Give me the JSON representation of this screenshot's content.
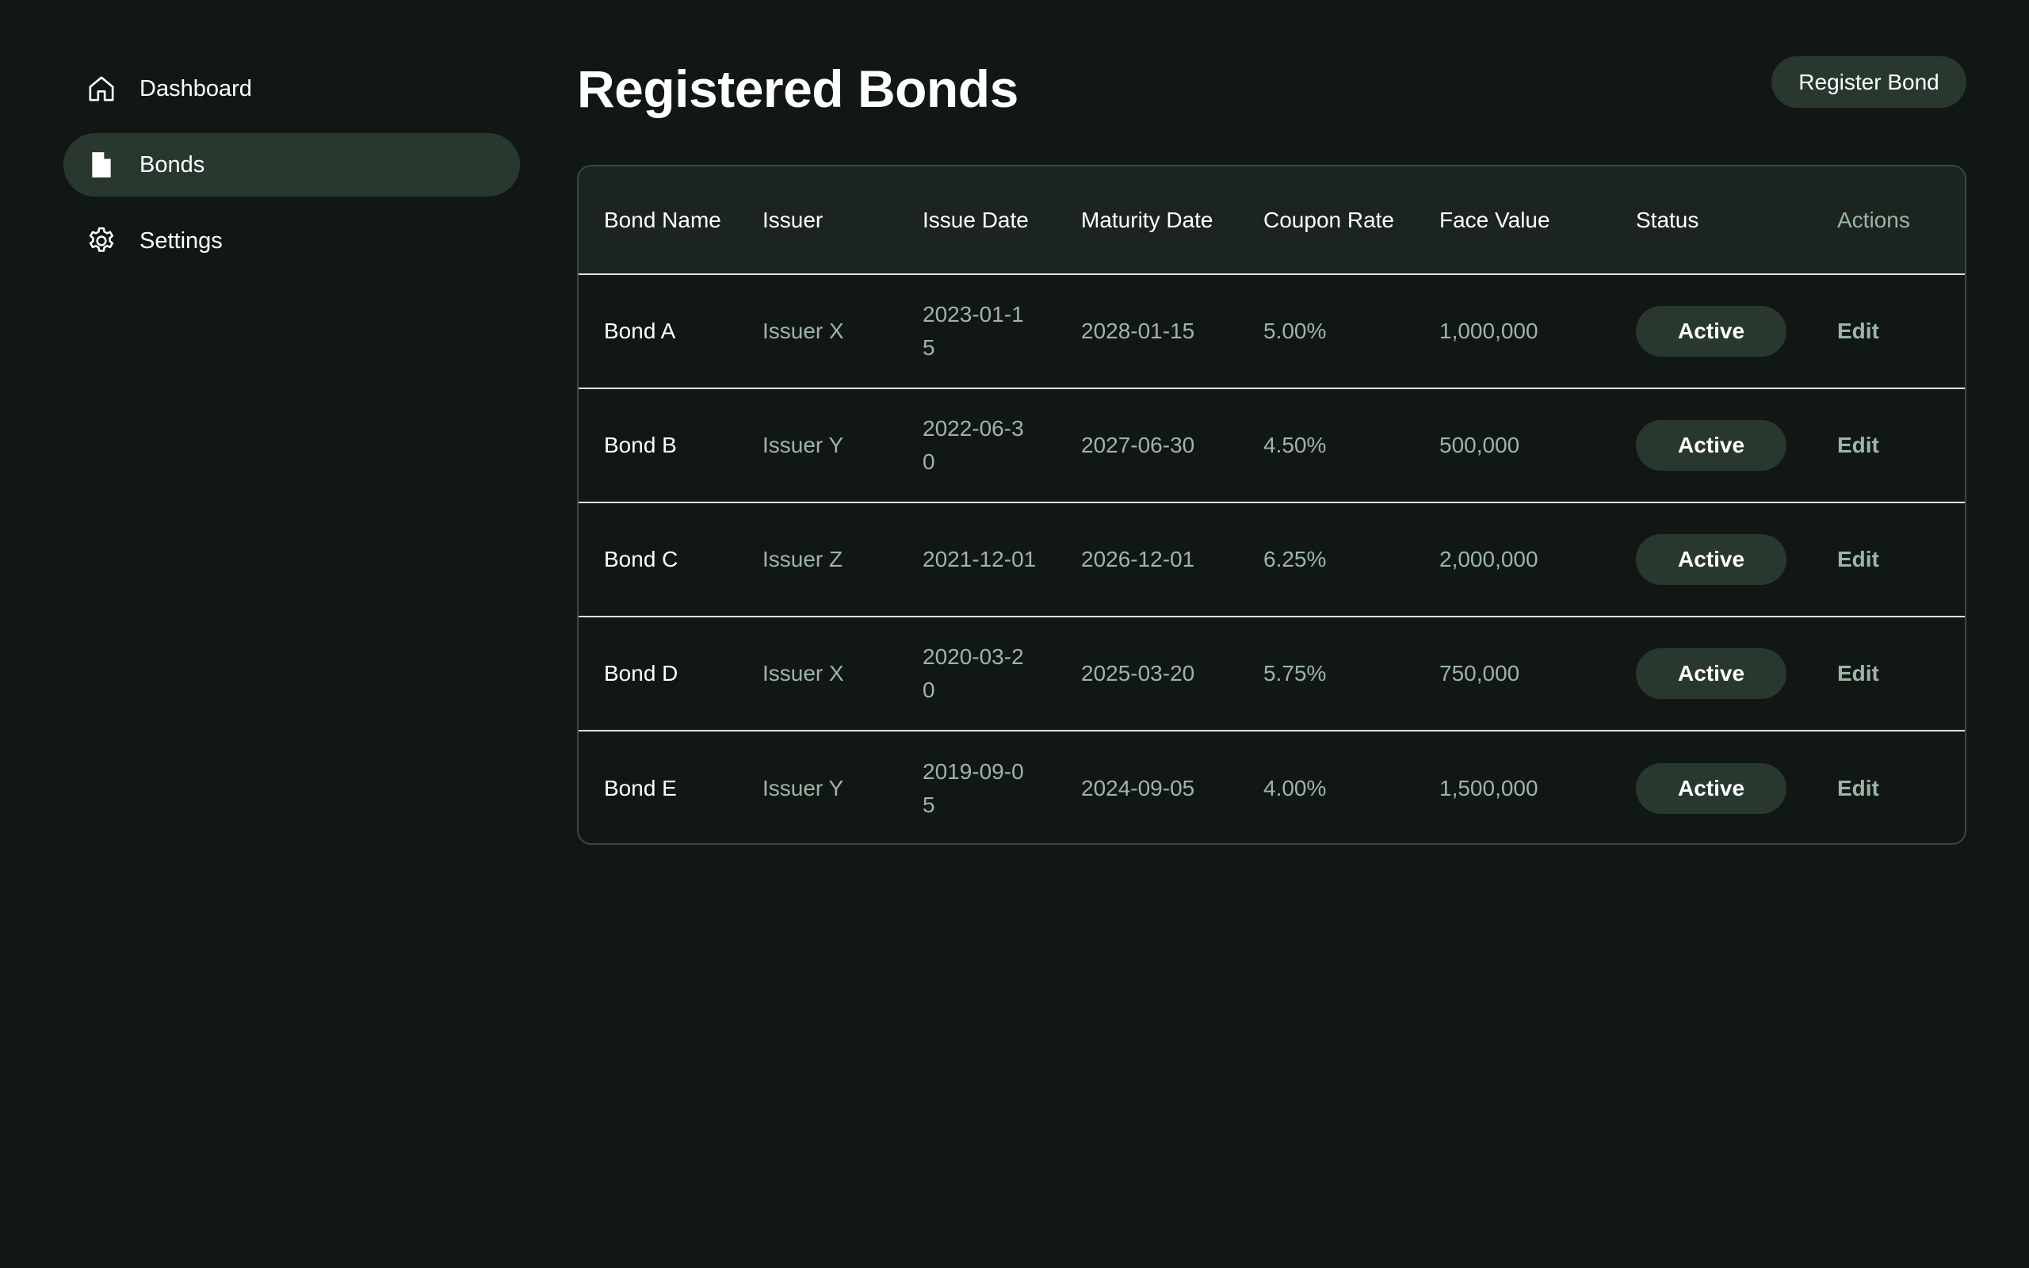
{
  "sidebar": {
    "items": [
      {
        "label": "Dashboard",
        "icon": "home-icon",
        "active": false
      },
      {
        "label": "Bonds",
        "icon": "document-icon",
        "active": true
      },
      {
        "label": "Settings",
        "icon": "gear-icon",
        "active": false
      }
    ]
  },
  "header": {
    "title": "Registered Bonds",
    "register_button": "Register Bond"
  },
  "table": {
    "columns": {
      "bond_name": "Bond Name",
      "issuer": "Issuer",
      "issue_date": "Issue Date",
      "maturity_date": "Maturity Date",
      "coupon_rate": "Coupon Rate",
      "face_value": "Face Value",
      "status": "Status",
      "actions": "Actions"
    },
    "rows": [
      {
        "bond_name": "Bond A",
        "issuer": "Issuer X",
        "issue_date": "2023-01-15",
        "maturity_date": "2028-01-15",
        "coupon_rate": "5.00%",
        "face_value": "1,000,000",
        "status": "Active",
        "action": "Edit"
      },
      {
        "bond_name": "Bond B",
        "issuer": "Issuer Y",
        "issue_date": "2022-06-30",
        "maturity_date": "2027-06-30",
        "coupon_rate": "4.50%",
        "face_value": "500,000",
        "status": "Active",
        "action": "Edit"
      },
      {
        "bond_name": "Bond C",
        "issuer": "Issuer Z",
        "issue_date": "2021-12-01",
        "maturity_date": "2026-12-01",
        "coupon_rate": "6.25%",
        "face_value": "2,000,000",
        "status": "Active",
        "action": "Edit"
      },
      {
        "bond_name": "Bond D",
        "issuer": "Issuer X",
        "issue_date": "2020-03-20",
        "maturity_date": "2025-03-20",
        "coupon_rate": "5.75%",
        "face_value": "750,000",
        "status": "Active",
        "action": "Edit"
      },
      {
        "bond_name": "Bond E",
        "issuer": "Issuer Y",
        "issue_date": "2019-09-05",
        "maturity_date": "2024-09-05",
        "coupon_rate": "4.00%",
        "face_value": "1,500,000",
        "status": "Active",
        "action": "Edit"
      }
    ]
  },
  "colors": {
    "background": "#111714",
    "accent_surface": "#29382f",
    "header_surface": "#1c2420",
    "muted_text": "#9db5a6",
    "text": "#ffffff"
  }
}
